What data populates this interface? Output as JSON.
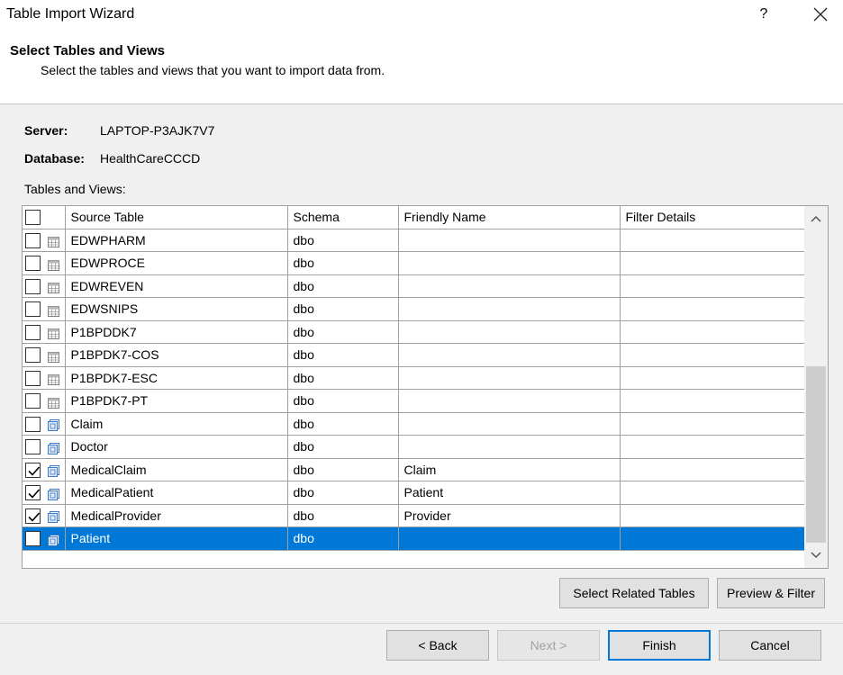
{
  "window": {
    "title": "Table Import Wizard",
    "help_label": "?"
  },
  "header": {
    "title": "Select Tables and Views",
    "subtitle": "Select the tables and views that you want to import data from."
  },
  "connection": {
    "server_label": "Server:",
    "server_value": "LAPTOP-P3AJK7V7",
    "database_label": "Database:",
    "database_value": "HealthCareCCCD",
    "tables_label": "Tables and Views:"
  },
  "grid": {
    "columns": [
      "Source Table",
      "Schema",
      "Friendly Name",
      "Filter Details"
    ],
    "rows": [
      {
        "name": "EDWPHARM",
        "schema": "dbo",
        "friendly": "",
        "filter": "",
        "checked": false,
        "icon": "table-icon",
        "selected": false
      },
      {
        "name": "EDWPROCE",
        "schema": "dbo",
        "friendly": "",
        "filter": "",
        "checked": false,
        "icon": "table-icon",
        "selected": false
      },
      {
        "name": "EDWREVEN",
        "schema": "dbo",
        "friendly": "",
        "filter": "",
        "checked": false,
        "icon": "table-icon",
        "selected": false
      },
      {
        "name": "EDWSNIPS",
        "schema": "dbo",
        "friendly": "",
        "filter": "",
        "checked": false,
        "icon": "table-icon",
        "selected": false
      },
      {
        "name": "P1BPDDK7",
        "schema": "dbo",
        "friendly": "",
        "filter": "",
        "checked": false,
        "icon": "table-icon",
        "selected": false
      },
      {
        "name": "P1BPDK7-COS",
        "schema": "dbo",
        "friendly": "",
        "filter": "",
        "checked": false,
        "icon": "table-icon",
        "selected": false
      },
      {
        "name": "P1BPDK7-ESC",
        "schema": "dbo",
        "friendly": "",
        "filter": "",
        "checked": false,
        "icon": "table-icon",
        "selected": false
      },
      {
        "name": "P1BPDK7-PT",
        "schema": "dbo",
        "friendly": "",
        "filter": "",
        "checked": false,
        "icon": "table-icon",
        "selected": false
      },
      {
        "name": "Claim",
        "schema": "dbo",
        "friendly": "",
        "filter": "",
        "checked": false,
        "icon": "view-icon",
        "selected": false
      },
      {
        "name": "Doctor",
        "schema": "dbo",
        "friendly": "",
        "filter": "",
        "checked": false,
        "icon": "view-icon",
        "selected": false
      },
      {
        "name": "MedicalClaim",
        "schema": "dbo",
        "friendly": "Claim",
        "filter": "",
        "checked": true,
        "icon": "view-icon",
        "selected": false
      },
      {
        "name": "MedicalPatient",
        "schema": "dbo",
        "friendly": "Patient",
        "filter": "",
        "checked": true,
        "icon": "view-icon",
        "selected": false
      },
      {
        "name": "MedicalProvider",
        "schema": "dbo",
        "friendly": "Provider",
        "filter": "",
        "checked": true,
        "icon": "view-icon",
        "selected": false
      },
      {
        "name": "Patient",
        "schema": "dbo",
        "friendly": "",
        "filter": "",
        "checked": false,
        "icon": "view-icon",
        "selected": true
      }
    ]
  },
  "buttons": {
    "select_related": "Select Related Tables",
    "preview_filter": "Preview & Filter",
    "back": "< Back",
    "next": "Next >",
    "finish": "Finish",
    "cancel": "Cancel"
  },
  "colors": {
    "selection": "#0078d7",
    "icon_blue": "#3c78c8"
  }
}
